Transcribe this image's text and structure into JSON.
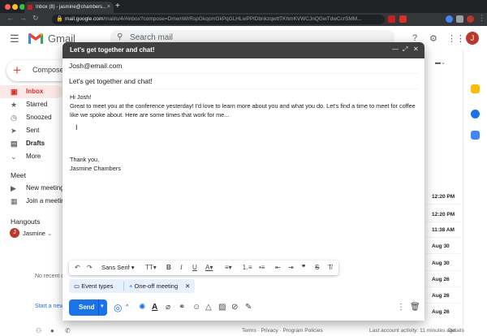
{
  "browser": {
    "tab_title": "Inbox (8) - jasmine@chambers...",
    "tab_close": "×",
    "new_tab": "+",
    "url_host": "mail.google.com",
    "url_path": "/mail/u/4/#inbox?compose=DmwnWrRspGkqcmGkPqGLHLwPPtDbnkzqwttTKhmKVWCJnQGwTdwCcrSMM...",
    "lock_glyph": "🔒"
  },
  "gmail": {
    "logo_text": "Gmail",
    "search_placeholder": "Search mail",
    "avatar_letter": "J",
    "compose_label": "Compose",
    "sidebar": {
      "items": [
        {
          "label": "Inbox",
          "glyph": "▣"
        },
        {
          "label": "Starred",
          "glyph": "★"
        },
        {
          "label": "Snoozed",
          "glyph": "◷"
        },
        {
          "label": "Sent",
          "glyph": "➤"
        },
        {
          "label": "Drafts",
          "glyph": "▤"
        },
        {
          "label": "More",
          "glyph": "⌄"
        }
      ],
      "meet_heading": "Meet",
      "meet_items": [
        {
          "label": "New meeting",
          "glyph": "▶"
        },
        {
          "label": "Join a meeting",
          "glyph": "▦"
        }
      ],
      "hangouts_heading": "Hangouts",
      "hangouts_user": "Jasmine",
      "hangouts_user_caret": "⌄",
      "no_recent": "No recent c",
      "start_new": "Start a new"
    },
    "row_dates": [
      "12:20 PM",
      "12:20 PM",
      "11:38 AM",
      "Aug 30",
      "Aug 30",
      "Aug 26",
      "Aug 26",
      "Aug 26"
    ],
    "footer": {
      "links": "Terms · Privacy · Program Policies",
      "activity": "Last account activity: 11 minutes ago",
      "details": "Details"
    }
  },
  "compose": {
    "title": "Let's get together and chat!",
    "to": "Josh@email.com",
    "subject": "Let's get together and chat!",
    "body": {
      "greeting": "Hi Josh!",
      "line1": "Great to meet you at the conference yesterday!  I'd love to learn more about you and what you do. Let's find a time to meet for coffee like we spoke about. Here are some times that work for me...",
      "signoff": "Thank you,",
      "signature": "Jasmine Chambers"
    },
    "format_font": "Sans Serif",
    "chips": {
      "event_types": "Event types",
      "one_off": "One-off meeting",
      "one_off_glyph": "+",
      "close_glyph": "✕"
    },
    "send_label": "Send",
    "send_arrow": "▾",
    "window_controls": {
      "minimize": "—",
      "expand": "⤢",
      "close": "✕"
    }
  },
  "colors": {
    "accent": "#1a73e8",
    "inbox_active": "#d93025",
    "compose_header": "#404040",
    "chip_bg": "#e8f0fe"
  }
}
